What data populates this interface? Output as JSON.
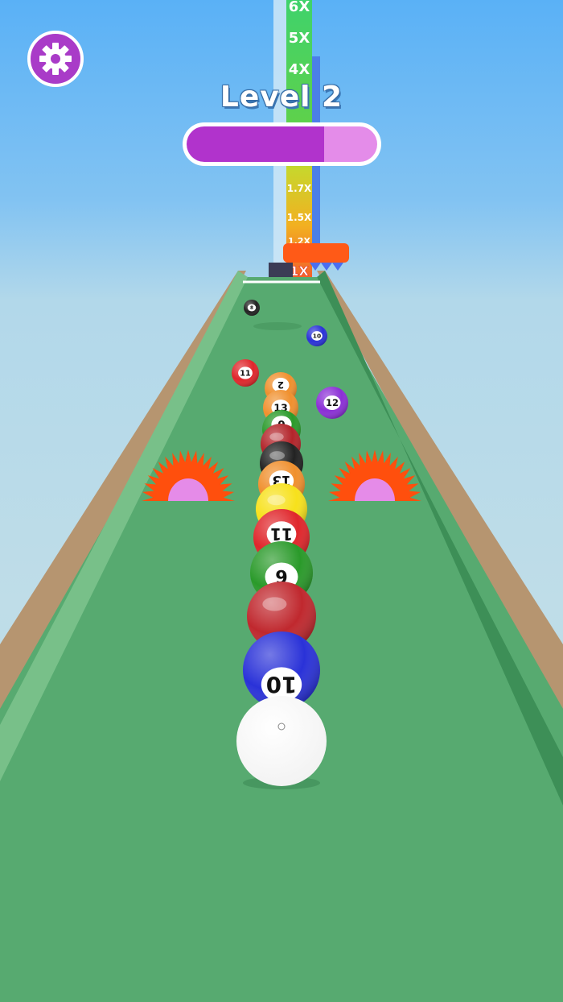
{
  "level": {
    "title": "Level 2"
  },
  "progress": {
    "value": 0.72
  },
  "settings": {
    "icon": "gear-icon"
  },
  "tower": {
    "multipliers": [
      "6X",
      "5X",
      "4X",
      "1.7X",
      "1.5X",
      "1.2X",
      "1X"
    ]
  },
  "track_balls": [
    {
      "number": "8",
      "color": "#222222"
    },
    {
      "number": "10",
      "color": "#2a32d8"
    },
    {
      "number": "11",
      "color": "#e0262b"
    },
    {
      "number": "12",
      "color": "#8b2fd6"
    }
  ],
  "chain_balls": [
    {
      "number": "2",
      "color": "#f0902e"
    },
    {
      "number": "13",
      "color": "#f0902e"
    },
    {
      "number": "6",
      "color": "#2a9a2a"
    },
    {
      "number": "",
      "color": "#b3242a"
    },
    {
      "number": "",
      "color": "#222222"
    },
    {
      "number": "13",
      "color": "#f0902e"
    },
    {
      "number": "",
      "color": "#f7e11b"
    },
    {
      "number": "11",
      "color": "#e0262b"
    },
    {
      "number": "6",
      "color": "#2a9a2a"
    },
    {
      "number": "",
      "color": "#c0282e"
    },
    {
      "number": "10",
      "color": "#2a32d8"
    }
  ],
  "colors": {
    "track": "#57aa70",
    "side": "#b69570",
    "saw": "#ff4f0d",
    "saw_hub": "#e58be8",
    "accent": "#b133cc"
  }
}
